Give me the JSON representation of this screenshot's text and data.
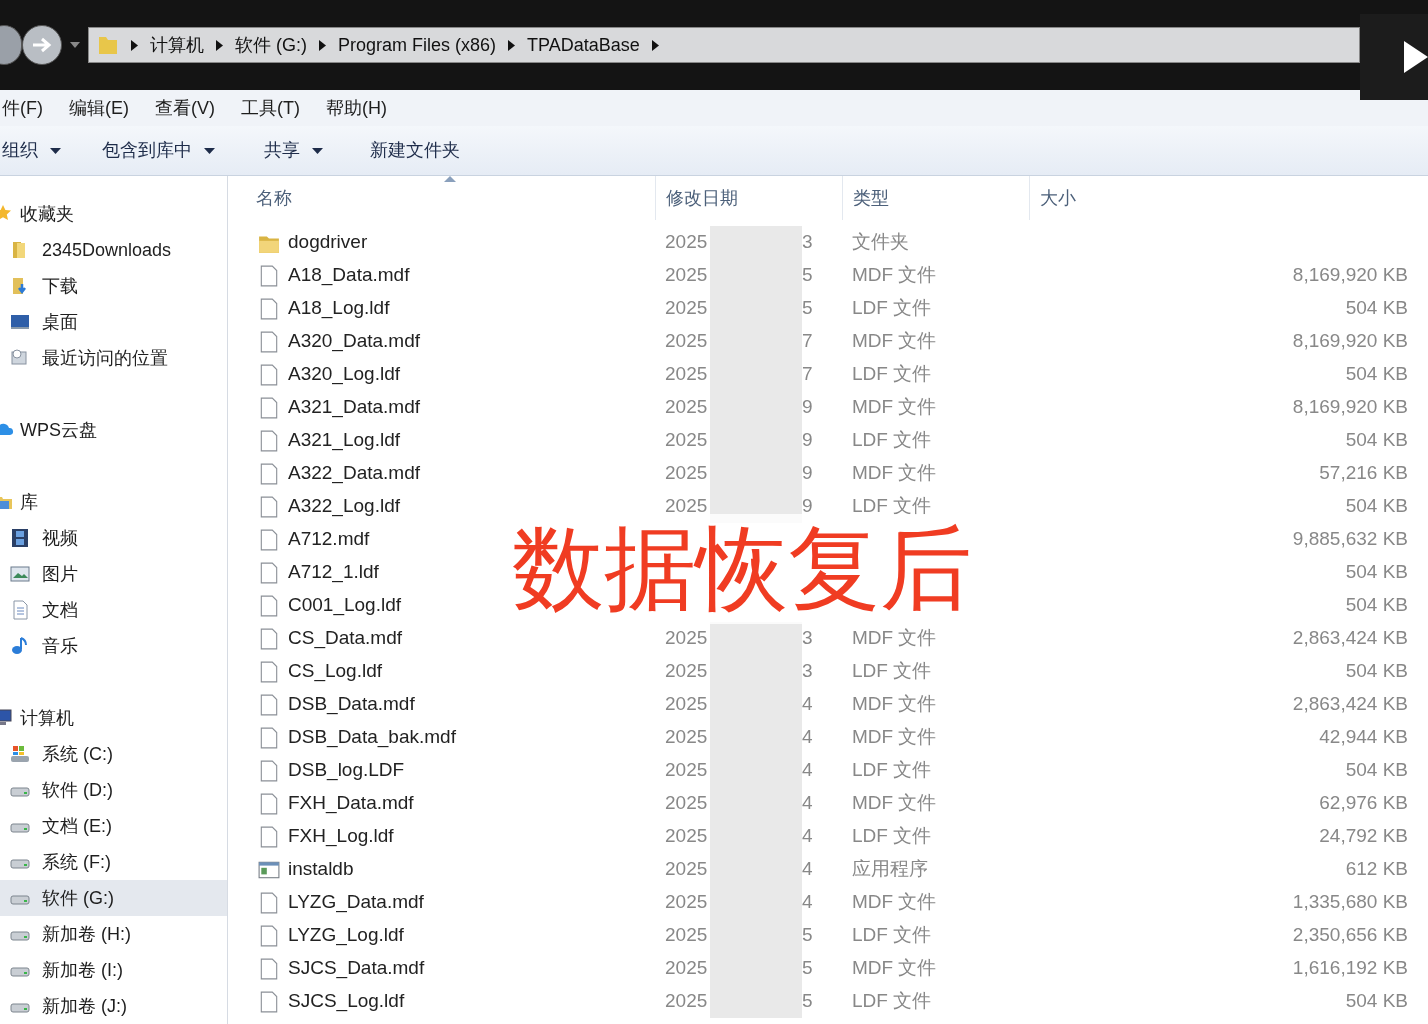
{
  "address_bar": {
    "path": [
      "计算机",
      "软件 (G:)",
      "Program Files (x86)",
      "TPADataBase"
    ]
  },
  "menu_bar": [
    "件(F)",
    "编辑(E)",
    "查看(V)",
    "工具(T)",
    "帮助(H)"
  ],
  "toolbar": [
    {
      "label": "组织",
      "dropdown": true
    },
    {
      "label": "包含到库中",
      "dropdown": true
    },
    {
      "label": "共享",
      "dropdown": true
    },
    {
      "label": "新建文件夹",
      "dropdown": false
    }
  ],
  "sidebar": {
    "groups": [
      {
        "label": "收藏夹",
        "kind": "star",
        "items": [
          {
            "label": "2345Downloads",
            "kind": "folder",
            "selected": false
          },
          {
            "label": "下载",
            "kind": "download",
            "selected": false
          },
          {
            "label": "桌面",
            "kind": "desktop",
            "selected": false
          },
          {
            "label": "最近访问的位置",
            "kind": "recent",
            "selected": false
          }
        ]
      },
      {
        "label": "WPS云盘",
        "kind": "cloud"
      },
      {
        "label": "库",
        "kind": "library",
        "items": [
          {
            "label": "视频",
            "kind": "video",
            "selected": false
          },
          {
            "label": "图片",
            "kind": "picture",
            "selected": false
          },
          {
            "label": "文档",
            "kind": "document",
            "selected": false
          },
          {
            "label": "音乐",
            "kind": "music",
            "selected": false
          }
        ]
      },
      {
        "label": "计算机",
        "kind": "computer",
        "items": [
          {
            "label": "系统 (C:)",
            "kind": "system-drive",
            "selected": false
          },
          {
            "label": "软件 (D:)",
            "kind": "drive",
            "selected": false
          },
          {
            "label": "文档 (E:)",
            "kind": "drive",
            "selected": false
          },
          {
            "label": "系统 (F:)",
            "kind": "drive",
            "selected": false
          },
          {
            "label": "软件 (G:)",
            "kind": "drive",
            "selected": true
          },
          {
            "label": "新加卷 (H:)",
            "kind": "drive",
            "selected": false
          },
          {
            "label": "新加卷 (I:)",
            "kind": "drive",
            "selected": false
          },
          {
            "label": "新加卷 (J:)",
            "kind": "drive",
            "selected": false
          }
        ]
      }
    ]
  },
  "file_list": {
    "columns": [
      "名称",
      "修改日期",
      "类型",
      "大小"
    ],
    "rows": [
      {
        "name": "dogdriver",
        "kind": "folder",
        "date_start": "2025",
        "date_end": "3",
        "type": "文件夹",
        "size": ""
      },
      {
        "name": "A18_Data.mdf",
        "kind": "file",
        "date_start": "2025",
        "date_end": "5",
        "type": "MDF 文件",
        "size": "8,169,920 KB"
      },
      {
        "name": "A18_Log.ldf",
        "kind": "file",
        "date_start": "2025",
        "date_end": "5",
        "type": "LDF 文件",
        "size": "504 KB"
      },
      {
        "name": "A320_Data.mdf",
        "kind": "file",
        "date_start": "2025",
        "date_end": "7",
        "type": "MDF 文件",
        "size": "8,169,920 KB"
      },
      {
        "name": "A320_Log.ldf",
        "kind": "file",
        "date_start": "2025",
        "date_end": "7",
        "type": "LDF 文件",
        "size": "504 KB"
      },
      {
        "name": "A321_Data.mdf",
        "kind": "file",
        "date_start": "2025",
        "date_end": "9",
        "type": "MDF 文件",
        "size": "8,169,920 KB"
      },
      {
        "name": "A321_Log.ldf",
        "kind": "file",
        "date_start": "2025",
        "date_end": "9",
        "type": "LDF 文件",
        "size": "504 KB"
      },
      {
        "name": "A322_Data.mdf",
        "kind": "file",
        "date_start": "2025",
        "date_end": "9",
        "type": "MDF 文件",
        "size": "57,216 KB"
      },
      {
        "name": "A322_Log.ldf",
        "kind": "file",
        "date_start": "2025",
        "date_end": "9",
        "type": "LDF 文件",
        "size": "504 KB"
      },
      {
        "name": "A712.mdf",
        "kind": "file",
        "date_start": "",
        "date_end": "",
        "type": "",
        "size": "9,885,632 KB"
      },
      {
        "name": "A712_1.ldf",
        "kind": "file",
        "date_start": "",
        "date_end": "",
        "type": "",
        "size": "504 KB"
      },
      {
        "name": "C001_Log.ldf",
        "kind": "file",
        "date_start": "",
        "date_end": "",
        "type": "",
        "size": "504 KB"
      },
      {
        "name": "CS_Data.mdf",
        "kind": "file",
        "date_start": "2025",
        "date_end": "3",
        "type": "MDF 文件",
        "size": "2,863,424 KB"
      },
      {
        "name": "CS_Log.ldf",
        "kind": "file",
        "date_start": "2025",
        "date_end": "3",
        "type": "LDF 文件",
        "size": "504 KB"
      },
      {
        "name": "DSB_Data.mdf",
        "kind": "file",
        "date_start": "2025",
        "date_end": "4",
        "type": "MDF 文件",
        "size": "2,863,424 KB"
      },
      {
        "name": "DSB_Data_bak.mdf",
        "kind": "file",
        "date_start": "2025",
        "date_end": "4",
        "type": "MDF 文件",
        "size": "42,944 KB"
      },
      {
        "name": "DSB_log.LDF",
        "kind": "file",
        "date_start": "2025",
        "date_end": "4",
        "type": "LDF 文件",
        "size": "504 KB"
      },
      {
        "name": "FXH_Data.mdf",
        "kind": "file",
        "date_start": "2025",
        "date_end": "4",
        "type": "MDF 文件",
        "size": "62,976 KB"
      },
      {
        "name": "FXH_Log.ldf",
        "kind": "file",
        "date_start": "2025",
        "date_end": "4",
        "type": "LDF 文件",
        "size": "24,792 KB"
      },
      {
        "name": "instaldb",
        "kind": "app",
        "date_start": "2025",
        "date_end": "4",
        "type": "应用程序",
        "size": "612 KB"
      },
      {
        "name": "LYZG_Data.mdf",
        "kind": "file",
        "date_start": "2025",
        "date_end": "4",
        "type": "MDF 文件",
        "size": "1,335,680 KB"
      },
      {
        "name": "LYZG_Log.ldf",
        "kind": "file",
        "date_start": "2025",
        "date_end": "5",
        "type": "LDF 文件",
        "size": "2,350,656 KB"
      },
      {
        "name": "SJCS_Data.mdf",
        "kind": "file",
        "date_start": "2025",
        "date_end": "5",
        "type": "MDF 文件",
        "size": "1,616,192 KB"
      },
      {
        "name": "SJCS_Log.ldf",
        "kind": "file",
        "date_start": "2025",
        "date_end": "5",
        "type": "LDF 文件",
        "size": "504 KB"
      }
    ]
  },
  "overlay_caption": "数据恢复后"
}
